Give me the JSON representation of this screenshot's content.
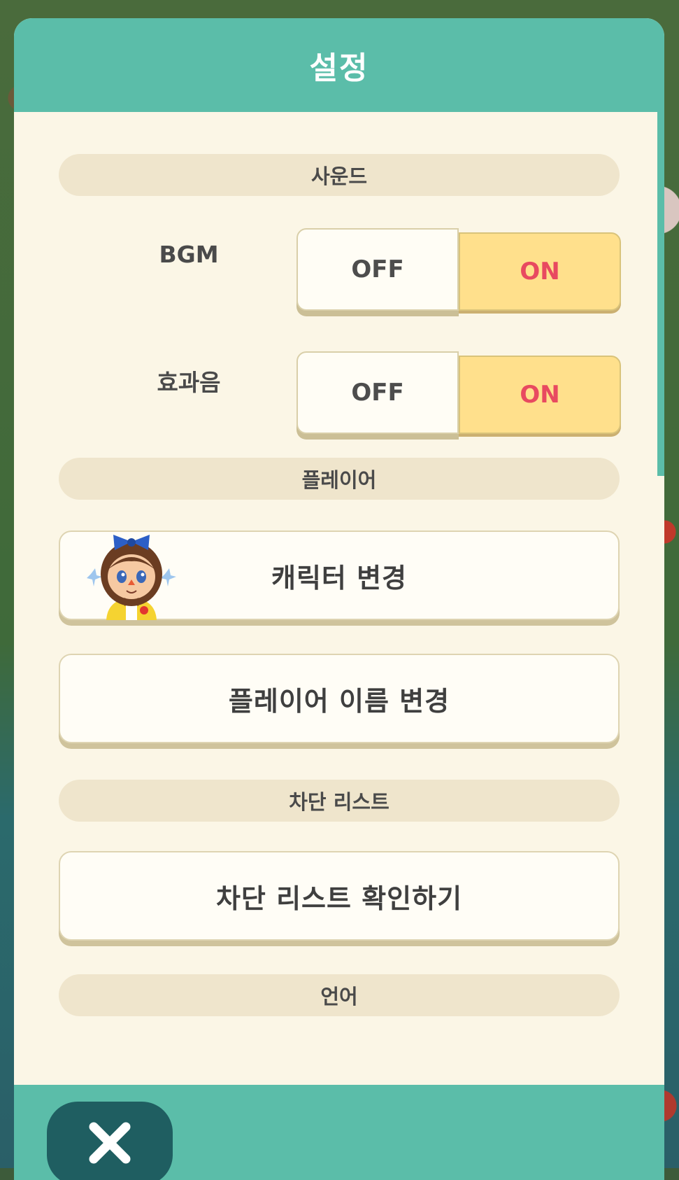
{
  "dialog": {
    "title": "설정"
  },
  "sections": {
    "sound": "사운드",
    "player": "플레이어",
    "block_list": "차단 리스트",
    "language": "언어"
  },
  "settings": {
    "bgm": {
      "label": "BGM",
      "off_label": "OFF",
      "on_label": "ON",
      "selected": "ON"
    },
    "sfx": {
      "label": "효과음",
      "off_label": "OFF",
      "on_label": "ON",
      "selected": "ON"
    }
  },
  "buttons": {
    "change_character": "캐릭터 변경",
    "change_player_name": "플레이어 이름 변경",
    "view_block_list": "차단 리스트 확인하기"
  },
  "icons": {
    "close": "close-x-icon",
    "avatar": "player-character-avatar"
  },
  "colors": {
    "header": "#5bbda9",
    "panel": "#fbf6e6",
    "toggle_on": "#ffe08c",
    "on_text": "#e84a60",
    "close_button": "#1f5e61"
  }
}
